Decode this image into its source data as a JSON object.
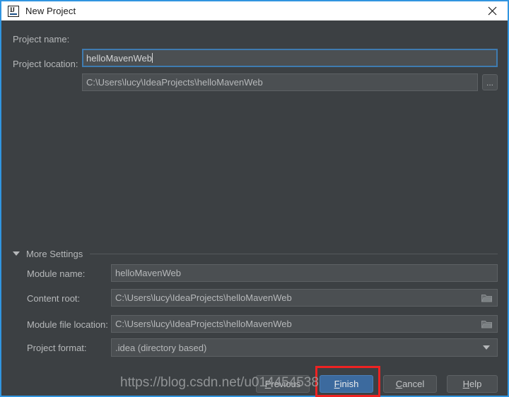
{
  "window": {
    "title": "New Project",
    "app_icon": "intellij-idea-icon",
    "close_icon": "close-icon",
    "accent_border": "#3195e0",
    "background": "#3c4043"
  },
  "form": {
    "project_name": {
      "label": "Project name:",
      "value": "helloMavenWeb",
      "focused": true
    },
    "project_location": {
      "label": "Project location:",
      "value": "C:\\Users\\lucy\\IdeaProjects\\helloMavenWeb",
      "browse_label": "..."
    }
  },
  "more_settings": {
    "label": "More Settings",
    "expanded": true,
    "collapse_icon": "chevron-down-icon",
    "fields": [
      {
        "name": "module-name",
        "label": "Module name:",
        "value": "helloMavenWeb",
        "icon": null
      },
      {
        "name": "content-root",
        "label": "Content root:",
        "value": "C:\\Users\\lucy\\IdeaProjects\\helloMavenWeb",
        "icon": "folder-icon"
      },
      {
        "name": "module-file-location",
        "label": "Module file location:",
        "value": "C:\\Users\\lucy\\IdeaProjects\\helloMavenWeb",
        "icon": "folder-icon"
      },
      {
        "name": "project-format",
        "label": "Project format:",
        "value": ".idea (directory based)",
        "icon": "chevron-down-icon"
      }
    ]
  },
  "buttons": {
    "previous": {
      "label": "Previous",
      "mnemonic": "P"
    },
    "finish": {
      "label": "Finish",
      "mnemonic": "F",
      "primary": true,
      "highlighted": true
    },
    "cancel": {
      "label": "Cancel",
      "mnemonic": "C"
    },
    "help": {
      "label": "Help",
      "mnemonic": "H"
    }
  },
  "annotation": {
    "highlight_color": "#ee2222",
    "watermark": "https://blog.csdn.net/u014454538"
  }
}
